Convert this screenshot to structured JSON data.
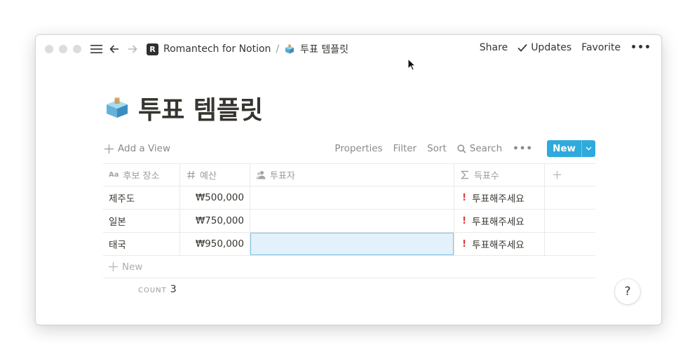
{
  "topbar": {
    "workspace_badge": "R",
    "workspace": "Romantech for Notion",
    "separator": "/",
    "page_crumb": "투표 템플릿",
    "share": "Share",
    "updates": "Updates",
    "favorite": "Favorite",
    "more": "•••"
  },
  "page": {
    "title": "투표 템플릿",
    "icon": "ballot-box-icon"
  },
  "toolbar": {
    "add_view": "Add a View",
    "properties": "Properties",
    "filter": "Filter",
    "sort": "Sort",
    "search": "Search",
    "more": "•••",
    "new": "New"
  },
  "table": {
    "headers": [
      "후보 장소",
      "예산",
      "투표자",
      "득표수"
    ],
    "header_icons": [
      "title-icon",
      "number-icon",
      "person-icon",
      "sigma-icon"
    ],
    "rows": [
      {
        "place": "제주도",
        "budget": "₩500,000",
        "voters": "",
        "votes": "투표해주세요"
      },
      {
        "place": "일본",
        "budget": "₩750,000",
        "voters": "",
        "votes": "투표해주세요"
      },
      {
        "place": "태국",
        "budget": "₩950,000",
        "voters": "",
        "votes": "투표해주세요"
      }
    ],
    "warn_mark": "!",
    "add_column": "+",
    "new_row": "New",
    "count_label": "COUNT",
    "count_value": "3"
  },
  "help": "?",
  "colors": {
    "accent": "#2eaadc",
    "warning": "#e03e3e",
    "selected": "#e2f1fa",
    "text": "#37352f"
  }
}
